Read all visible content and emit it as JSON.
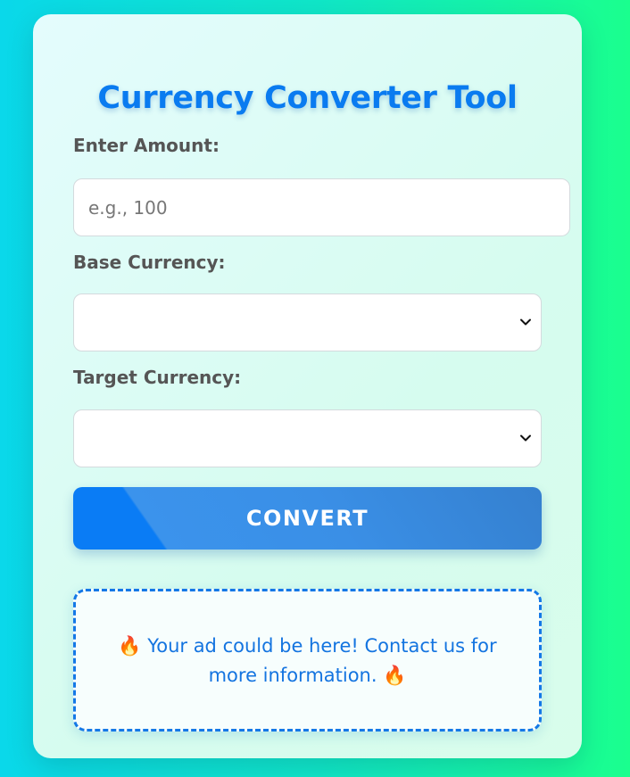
{
  "card": {
    "title": "Currency Converter Tool"
  },
  "amount": {
    "label": "Enter Amount:",
    "placeholder": "e.g., 100",
    "value": ""
  },
  "base_currency": {
    "label": "Base Currency:",
    "selected": "",
    "icon": "chevron-down-icon"
  },
  "target_currency": {
    "label": "Target Currency:",
    "selected": "",
    "icon": "chevron-down-icon"
  },
  "convert_button": {
    "label": "CONVERT"
  },
  "ad": {
    "emoji": "🔥",
    "text_line1": "Your ad could be here! Contact us for",
    "text_line2": "more information.",
    "icon": "fire-icon"
  },
  "colors": {
    "accent": "#0a7bf0",
    "label_text": "#555555",
    "ad_text": "#1474e0"
  }
}
